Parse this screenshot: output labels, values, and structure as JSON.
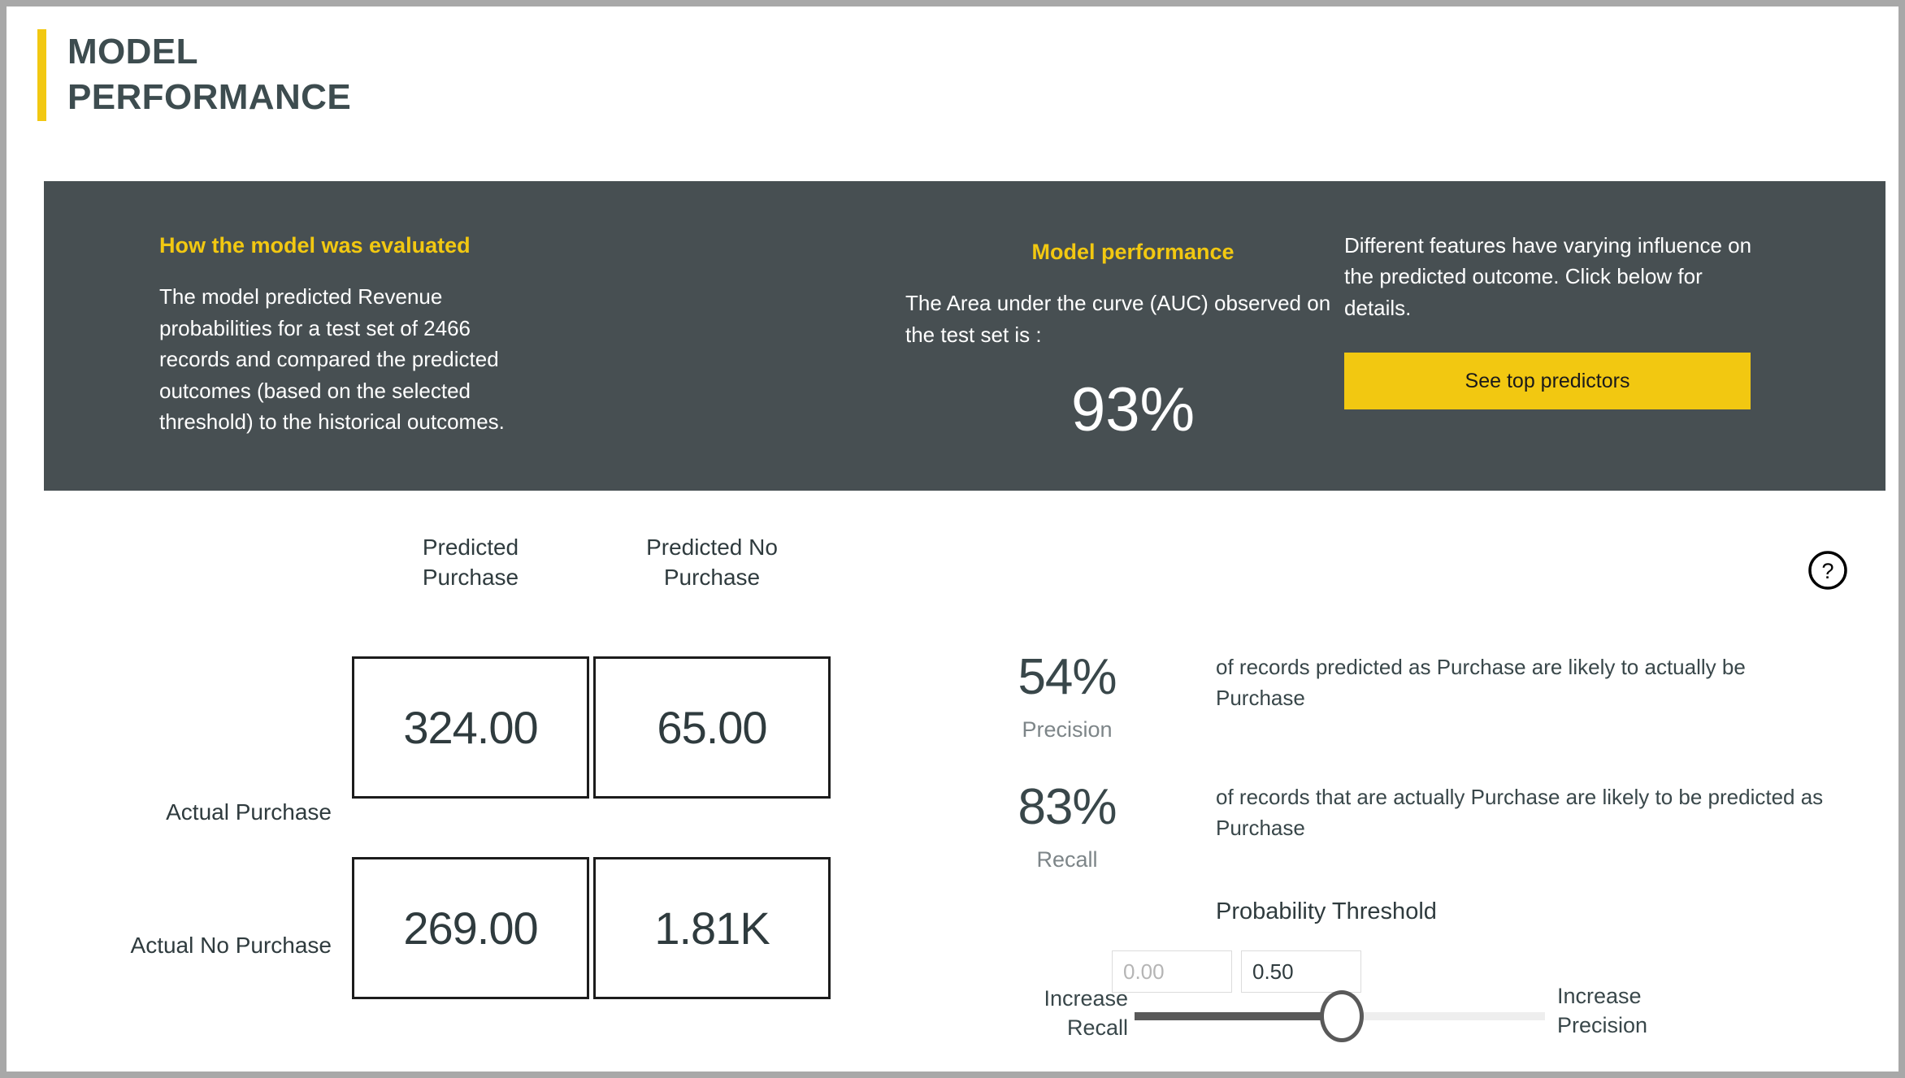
{
  "page": {
    "title": "MODEL\nPERFORMANCE",
    "accent_yellow": "#f2c811",
    "panel_dark": "#474f52",
    "text_dark": "#2f3b3e"
  },
  "info_panel": {
    "evaluation": {
      "heading": "How the model was evaluated",
      "body": "The model predicted Revenue probabilities for a test set of 2466 records and compared the predicted outcomes (based on the selected threshold) to the historical outcomes."
    },
    "performance": {
      "heading": "Model performance",
      "body": "The Area under the curve (AUC) observed on the test set is :",
      "auc_value": "93%"
    },
    "features": {
      "body": "Different features have varying influence on the predicted outcome.  Click below for details.",
      "button_label": "See top predictors"
    }
  },
  "matrix": {
    "column_headers": [
      "Predicted\nPurchase",
      "Predicted No\nPurchase"
    ],
    "row_headers": [
      "Actual Purchase",
      "Actual No Purchase"
    ],
    "cells": [
      [
        "324.00",
        "65.00"
      ],
      [
        "269.00",
        "1.81K"
      ]
    ]
  },
  "metrics": {
    "precision": {
      "value": "54%",
      "label": "Precision",
      "description": "of records predicted as Purchase are likely to actually be Purchase"
    },
    "recall": {
      "value": "83%",
      "label": "Recall",
      "description": "of records that are actually Purchase are likely to be predicted as Purchase"
    }
  },
  "threshold": {
    "title": "Probability Threshold",
    "min_placeholder": "0.00",
    "min_value": "",
    "max_value": "0.50",
    "left_label": "Increase\nRecall",
    "right_label": "Increase\nPrecision"
  },
  "icons": {
    "help": "help-circle-icon"
  },
  "chart_data": {
    "type": "table",
    "title": "Confusion Matrix",
    "categories": [
      "Predicted Purchase",
      "Predicted No Purchase"
    ],
    "rows": [
      "Actual Purchase",
      "Actual No Purchase"
    ],
    "values": [
      [
        324,
        65
      ],
      [
        269,
        1810
      ]
    ],
    "derived": {
      "auc": 0.93,
      "precision": 0.54,
      "recall": 0.83,
      "threshold": 0.5,
      "test_records": 2466
    }
  }
}
